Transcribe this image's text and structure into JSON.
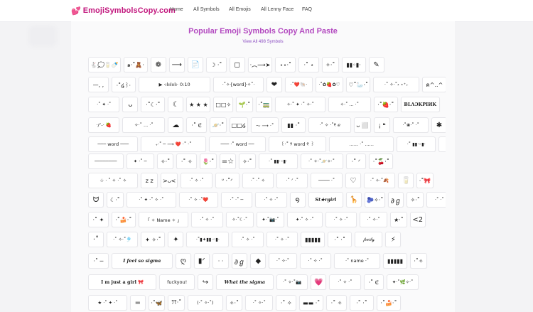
{
  "header": {
    "logo_icon": "💕",
    "logo_text": "EmojiSymbolsCopy.com",
    "nav": [
      "Home",
      "All Symbols",
      "All Emojis",
      "All Lenny Face",
      "FAQ"
    ]
  },
  "main": {
    "title": "Popular Emoji Symbols Copy And Paste",
    "subtitle": "View All 498 Symbols"
  },
  "symbol_rows": [
    [
      "🐇💭🥛🍼",
      "๑·˚🧸·",
      "❁",
      "⟶",
      "📄",
      "☽ ·˚",
      "◻︎",
      "·︵⟶➤",
      "⋆⋆·˚",
      "·˚ ⋆",
      "✧·˚",
      "▮▮◦▮·",
      "✎"
    ],
    [
      "—, ,",
      "·˚໒꒱·",
      "▶ ·ılıılıılı· 0:10",
      "·˚✧{word}✧˚·",
      "❤",
      "·˚❤️🐚·",
      "·˚✿🍓✿♡",
      "♡˚🦢·˚",
      "·˚ ✧·˚˖ ⋆⁺₊",
      "ค^..^",
      "·˚✧·"
    ],
    [
      "·˚ ✦ ·˚",
      "ᴗ",
      "·˚☾·˚",
      "☾",
      "★ ★ ★",
      "□□✧",
      "🌱·˚",
      "·˚🚃",
      "✧·˚ ✦ ·˚ ✧·˚",
      "✧·˚ ... ·˚",
      "·˚🍓·˚",
      "BLΛƆKPIИK"
    ],
    [
      "·/ᐟ-· 🍓",
      "✧·˚ ... ·˚",
      "☁",
      "·˚ ℭ",
      "🪐·˚",
      "□□໒",
      "〜 ⟶ ·˚",
      "▮▮ ·˚",
      "·˚ ✧ ·˚୧ ℯ",
      "ᴗ ⬜",
      "¡ ❝",
      "·˚❀·˚ ·˚",
      "✱"
    ],
    [
      "─── word ───",
      "₊·˚ ─ ⟶ ❤️ ·˚ ·˚",
      "─── ·˚ word ──",
      "꒰·˚ ୨ word ୧ ꒱",
      "...... ·˚ ......",
      "·˚ ▮▮·◦▮·",
      "·˚ ❝ [] ❞",
      "✧·˚ ⋆ name ⋆ ˚·✧"
    ],
    [
      "────────",
      "✦ ·˚ ─",
      "✧·˚",
      "·˚ ✧",
      "🌷·˚",
      "=☆",
      "✧·˚",
      "·˚ ▮▮·◦▮·",
      "·˚ ✧·˚🪐✧·˚",
      "·˚ ᐟ",
      "·˚🍒·˚"
    ],
    [
      "☆ · ˚ ✧ ·˚ ✧",
      "z z",
      ">ᴗ<",
      "·˚ ✧ ·˚",
      "ᐡ ·˚ᐟ",
      "·˚ ·˚ ✧",
      "·˚ ᐟ ·˚",
      "──── ·˚",
      "♡",
      "·˚ ✧·˚🍂",
      "🥛",
      "·˚🎀"
    ],
    [
      "ᗢ",
      "☾·˚",
      "·˚ ✦ ·˚ ✧ ·˚",
      "·˚ ✧ ·˚❤️",
      "·˚ ·˚ ─",
      "·˚ ✧ ·˚",
      "໑",
      "St★rgirl",
      "🦒",
      "🫐✧·˚",
      "∂ℊ",
      "✧·˚",
      "·˚ ·˚ 🍂❤️"
    ],
    [
      "·˚ ✦",
      "·˚🍰·˚",
      "「 ✧ Name ✧ 」",
      "·˚ ✧ ·˚",
      "✧·˚☾·˚",
      "✦·˚📷·˚",
      "✦·˚ ✧ ·˚",
      "·˚ ✧ ·˚",
      "·˚ ✧·˚",
      "★·˚",
      "<2"
    ],
    [
      "·˚",
      "·˚ ✧·˚🎐",
      "✦ ✧·˚",
      "✦",
      "·˚▮✦▮▮·◦▮·",
      "·˚ ✧ ·˚",
      "·˚ ✧ ·˚",
      "▮▮▮▮▮",
      "·˚ ·˚",
      "𝒻𝓇𝑒𝒾𝓁𝓎",
      "⚡"
    ],
    [
      "·˚ ─",
      "I feel so sigma",
      "ღ",
      "▮ᐟ",
      "· ·",
      "∂ℊ",
      "◆",
      "·˚ ✧·˚",
      "·˚ ✧ ·˚",
      "·˚ name ·˚ ",
      "▮▮▮▮▮",
      "·˚✧"
    ],
    [
      "I m just a girl 🎀",
      "fuckyou!",
      "↪",
      "What the sigma",
      "·˚ ✧·˚📷",
      "💗",
      "·˚ ✧ ·˚",
      "·˚ ℭ",
      "✦·˚🌿✧·˚"
    ],
    [
      "★ ·˚ ✦ ·˚",
      "=",
      "·˚🦋",
      "ꔫ·˚",
      "(·˚ ✧·˚)",
      "✧·˚",
      "·˚ ✧·˚",
      "·˚ ✧",
      "▬▬ ·˚",
      "·˚ ✧",
      "·˚ ·˚",
      "·˚🍰·˚"
    ]
  ]
}
